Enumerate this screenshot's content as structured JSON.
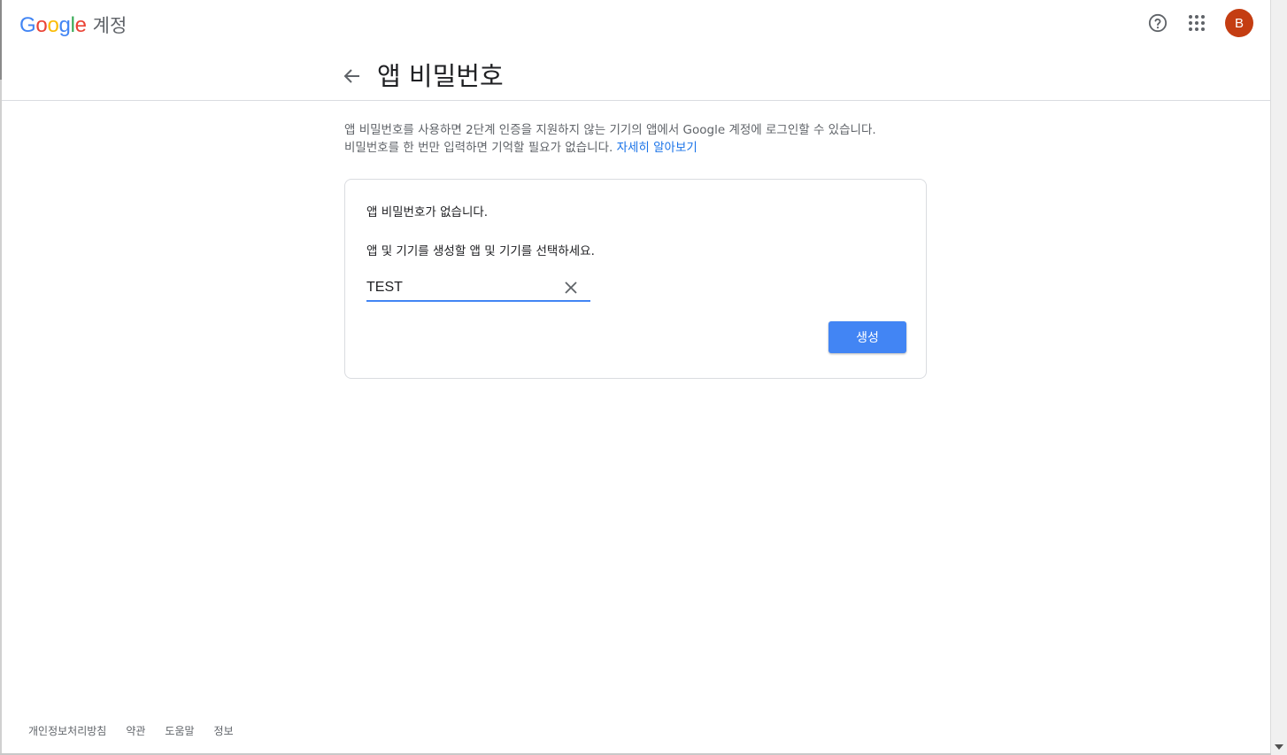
{
  "header": {
    "logo": [
      "G",
      "o",
      "o",
      "g",
      "l",
      "e"
    ],
    "product_name": "계정",
    "avatar_initial": "B"
  },
  "page": {
    "title": "앱 비밀번호",
    "description_line1": "앱 비밀번호를 사용하면 2단계 인증을 지원하지 않는 기기의 앱에서 Google 계정에 로그인할 수 있습니다.",
    "description_line2": "비밀번호를 한 번만 입력하면 기억할 필요가 없습니다.",
    "learn_more": "자세히 알아보기"
  },
  "card": {
    "no_passwords": "앱 비밀번호가 없습니다.",
    "instruction": "앱 및 기기를 생성할 앱 및 기기를 선택하세요.",
    "input_value": "TEST",
    "generate_label": "생성"
  },
  "footer": {
    "links": [
      "개인정보처리방침",
      "약관",
      "도움말",
      "정보"
    ]
  },
  "colors": {
    "accent": "#4285f4",
    "avatar": "#c43d12",
    "link": "#1a73e8"
  }
}
